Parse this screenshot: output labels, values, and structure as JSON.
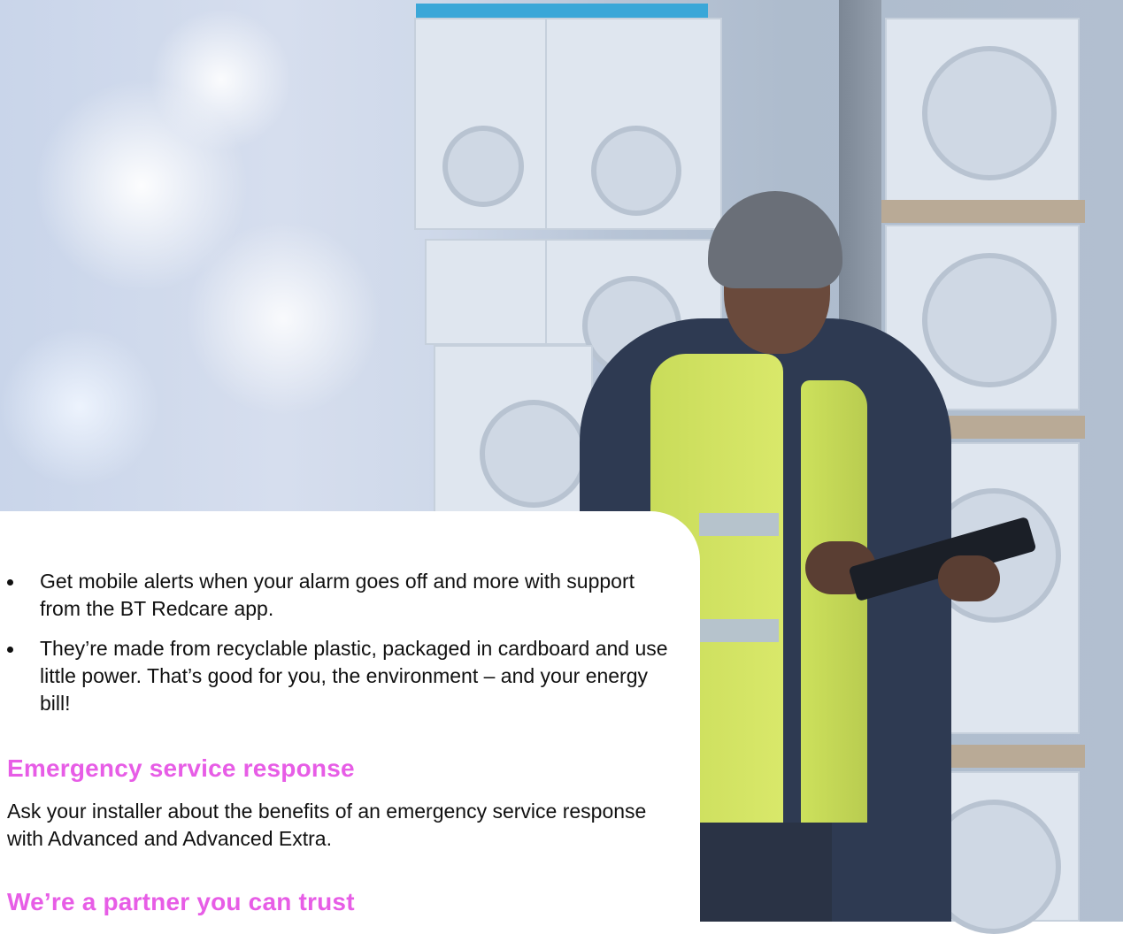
{
  "bullets": [
    "Get mobile alerts when your alarm goes off and more with support from the BT Redcare app.",
    "They’re made from recyclable plastic, packaged in cardboard and use little power. That’s good for you, the environment – and your energy bill!"
  ],
  "sections": [
    {
      "heading": "Emergency service response",
      "body": "Ask your installer about the benefits of an emergency service response with Advanced and Advanced Extra."
    },
    {
      "heading": "We’re a partner you can trust"
    }
  ],
  "colors": {
    "heading": "#e75de6",
    "text": "#111111"
  }
}
